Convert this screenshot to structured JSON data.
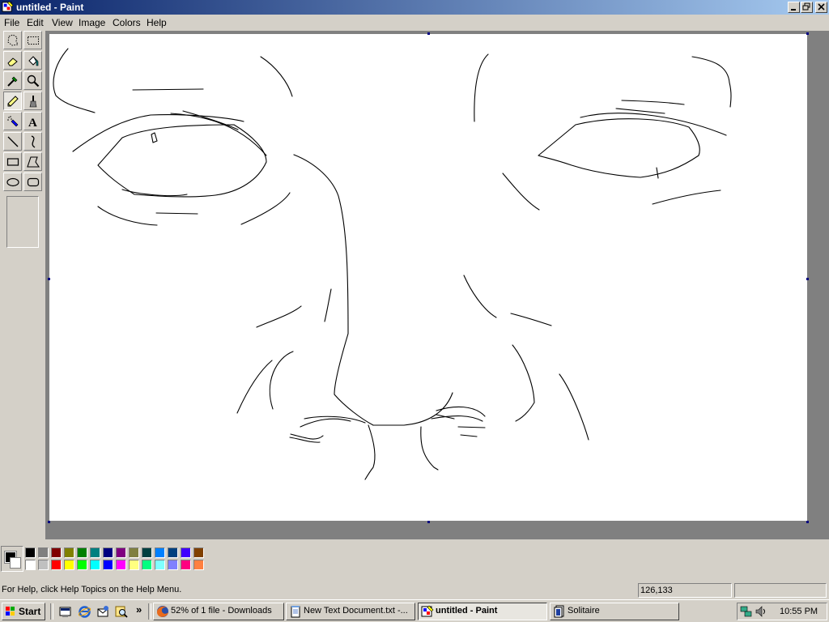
{
  "window": {
    "title": "untitled - Paint"
  },
  "menu": [
    "File",
    "Edit",
    "View",
    "Image",
    "Colors",
    "Help"
  ],
  "toolbox": {
    "tools": [
      "free-form-select",
      "select",
      "eraser",
      "fill-with-color",
      "pick-color",
      "magnifier",
      "pencil",
      "brush",
      "airbrush",
      "text",
      "line",
      "curve",
      "rectangle",
      "polygon",
      "ellipse",
      "rounded-rectangle"
    ],
    "selected": "pencil"
  },
  "palette": {
    "foreground": "#000000",
    "background": "#ffffff",
    "top_row": [
      "#000000",
      "#808080",
      "#800000",
      "#808000",
      "#008000",
      "#008080",
      "#000080",
      "#800080",
      "#808040",
      "#004040",
      "#0080ff",
      "#004080",
      "#4000ff",
      "#804000"
    ],
    "bottom_row": [
      "#ffffff",
      "#c0c0c0",
      "#ff0000",
      "#ffff00",
      "#00ff00",
      "#00ffff",
      "#0000ff",
      "#ff00ff",
      "#ffff80",
      "#00ff80",
      "#80ffff",
      "#8080ff",
      "#ff0080",
      "#ff8040"
    ]
  },
  "status": {
    "help_text": "For Help, click Help Topics on the Help Menu.",
    "coords": "126,133",
    "size": ""
  },
  "taskbar": {
    "start_label": "Start",
    "quick_launch": [
      "show-desktop-icon",
      "internet-explorer-icon",
      "outlook-express-icon",
      "search-icon"
    ],
    "tasks": [
      {
        "label": "52% of 1 file - Downloads",
        "icon": "firefox-icon",
        "active": false
      },
      {
        "label": "New Text Document.txt -...",
        "icon": "notepad-icon",
        "active": false
      },
      {
        "label": "untitled - Paint",
        "icon": "paint-icon",
        "active": true
      },
      {
        "label": "Solitaire",
        "icon": "solitaire-icon",
        "active": false
      }
    ],
    "clock": "10:55 PM"
  }
}
